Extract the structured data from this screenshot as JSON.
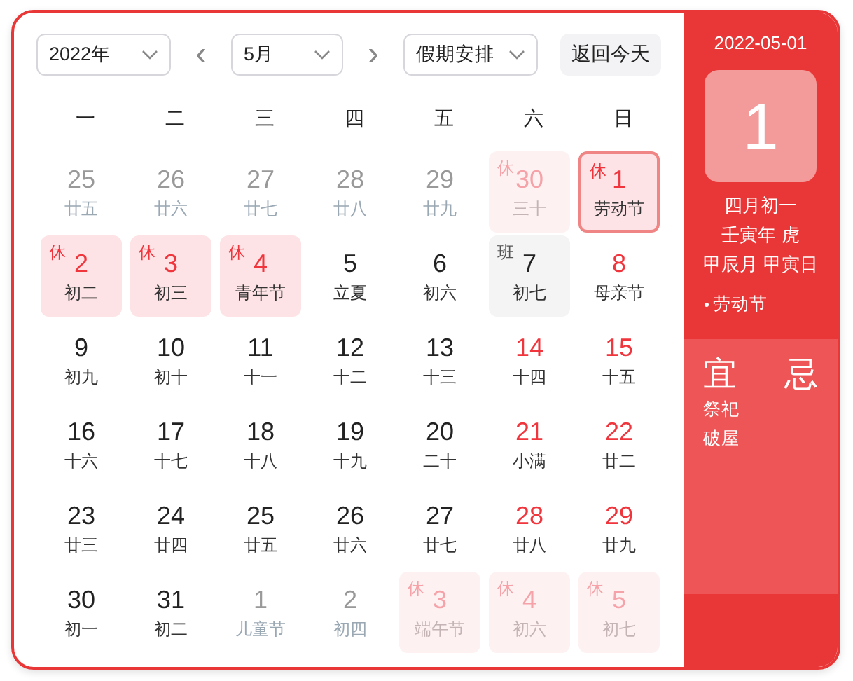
{
  "toolbar": {
    "year": "2022年",
    "prev": "‹",
    "month": "5月",
    "next": "›",
    "holiday_select": "假期安排",
    "today_button": "返回今天"
  },
  "weekdays": [
    "一",
    "二",
    "三",
    "四",
    "五",
    "六",
    "日"
  ],
  "days": [
    {
      "day": "25",
      "lunar": "廿五",
      "other_month": true,
      "red": false,
      "selected": false
    },
    {
      "day": "26",
      "lunar": "廿六",
      "other_month": true,
      "red": false,
      "selected": false
    },
    {
      "day": "27",
      "lunar": "廿七",
      "other_month": true,
      "red": false,
      "selected": false
    },
    {
      "day": "28",
      "lunar": "廿八",
      "other_month": true,
      "red": false,
      "selected": false
    },
    {
      "day": "29",
      "lunar": "廿九",
      "other_month": true,
      "red": false,
      "selected": false
    },
    {
      "day": "30",
      "lunar": "三十",
      "other_month": true,
      "red": true,
      "badge": {
        "text": "休",
        "kind": "rest"
      },
      "selected": false
    },
    {
      "day": "1",
      "lunar": "劳动节",
      "other_month": false,
      "red": true,
      "badge": {
        "text": "休",
        "kind": "rest"
      },
      "selected": true
    },
    {
      "day": "2",
      "lunar": "初二",
      "other_month": false,
      "red": true,
      "badge": {
        "text": "休",
        "kind": "rest"
      },
      "selected": false
    },
    {
      "day": "3",
      "lunar": "初三",
      "other_month": false,
      "red": true,
      "badge": {
        "text": "休",
        "kind": "rest"
      },
      "selected": false
    },
    {
      "day": "4",
      "lunar": "青年节",
      "other_month": false,
      "red": true,
      "badge": {
        "text": "休",
        "kind": "rest"
      },
      "selected": false
    },
    {
      "day": "5",
      "lunar": "立夏",
      "other_month": false,
      "red": false,
      "selected": false
    },
    {
      "day": "6",
      "lunar": "初六",
      "other_month": false,
      "red": false,
      "selected": false
    },
    {
      "day": "7",
      "lunar": "初七",
      "other_month": false,
      "red": false,
      "badge": {
        "text": "班",
        "kind": "work"
      },
      "selected": false
    },
    {
      "day": "8",
      "lunar": "母亲节",
      "other_month": false,
      "red": true,
      "selected": false
    },
    {
      "day": "9",
      "lunar": "初九",
      "other_month": false,
      "red": false,
      "selected": false
    },
    {
      "day": "10",
      "lunar": "初十",
      "other_month": false,
      "red": false,
      "selected": false
    },
    {
      "day": "11",
      "lunar": "十一",
      "other_month": false,
      "red": false,
      "selected": false
    },
    {
      "day": "12",
      "lunar": "十二",
      "other_month": false,
      "red": false,
      "selected": false
    },
    {
      "day": "13",
      "lunar": "十三",
      "other_month": false,
      "red": false,
      "selected": false
    },
    {
      "day": "14",
      "lunar": "十四",
      "other_month": false,
      "red": true,
      "selected": false
    },
    {
      "day": "15",
      "lunar": "十五",
      "other_month": false,
      "red": true,
      "selected": false
    },
    {
      "day": "16",
      "lunar": "十六",
      "other_month": false,
      "red": false,
      "selected": false
    },
    {
      "day": "17",
      "lunar": "十七",
      "other_month": false,
      "red": false,
      "selected": false
    },
    {
      "day": "18",
      "lunar": "十八",
      "other_month": false,
      "red": false,
      "selected": false
    },
    {
      "day": "19",
      "lunar": "十九",
      "other_month": false,
      "red": false,
      "selected": false
    },
    {
      "day": "20",
      "lunar": "二十",
      "other_month": false,
      "red": false,
      "selected": false
    },
    {
      "day": "21",
      "lunar": "小满",
      "other_month": false,
      "red": true,
      "selected": false
    },
    {
      "day": "22",
      "lunar": "廿二",
      "other_month": false,
      "red": true,
      "selected": false
    },
    {
      "day": "23",
      "lunar": "廿三",
      "other_month": false,
      "red": false,
      "selected": false
    },
    {
      "day": "24",
      "lunar": "廿四",
      "other_month": false,
      "red": false,
      "selected": false
    },
    {
      "day": "25",
      "lunar": "廿五",
      "other_month": false,
      "red": false,
      "selected": false
    },
    {
      "day": "26",
      "lunar": "廿六",
      "other_month": false,
      "red": false,
      "selected": false
    },
    {
      "day": "27",
      "lunar": "廿七",
      "other_month": false,
      "red": false,
      "selected": false
    },
    {
      "day": "28",
      "lunar": "廿八",
      "other_month": false,
      "red": true,
      "selected": false
    },
    {
      "day": "29",
      "lunar": "廿九",
      "other_month": false,
      "red": true,
      "selected": false
    },
    {
      "day": "30",
      "lunar": "初一",
      "other_month": false,
      "red": false,
      "selected": false
    },
    {
      "day": "31",
      "lunar": "初二",
      "other_month": false,
      "red": false,
      "selected": false
    },
    {
      "day": "1",
      "lunar": "儿童节",
      "other_month": true,
      "red": false,
      "selected": false
    },
    {
      "day": "2",
      "lunar": "初四",
      "other_month": true,
      "red": false,
      "selected": false
    },
    {
      "day": "3",
      "lunar": "端午节",
      "other_month": true,
      "red": true,
      "badge": {
        "text": "休",
        "kind": "rest"
      },
      "selected": false
    },
    {
      "day": "4",
      "lunar": "初六",
      "other_month": true,
      "red": true,
      "badge": {
        "text": "休",
        "kind": "rest"
      },
      "selected": false
    },
    {
      "day": "5",
      "lunar": "初七",
      "other_month": true,
      "red": true,
      "badge": {
        "text": "休",
        "kind": "rest"
      },
      "selected": false
    }
  ],
  "detail": {
    "date": "2022-05-01",
    "day": "1",
    "lunar_lines": [
      "四月初一",
      "壬寅年 虎",
      "甲辰月 甲寅日"
    ],
    "festivals": [
      "劳动节"
    ],
    "yi_title": "宜",
    "yi_items": [
      "祭祀",
      "破屋"
    ],
    "ji_title": "忌"
  }
}
